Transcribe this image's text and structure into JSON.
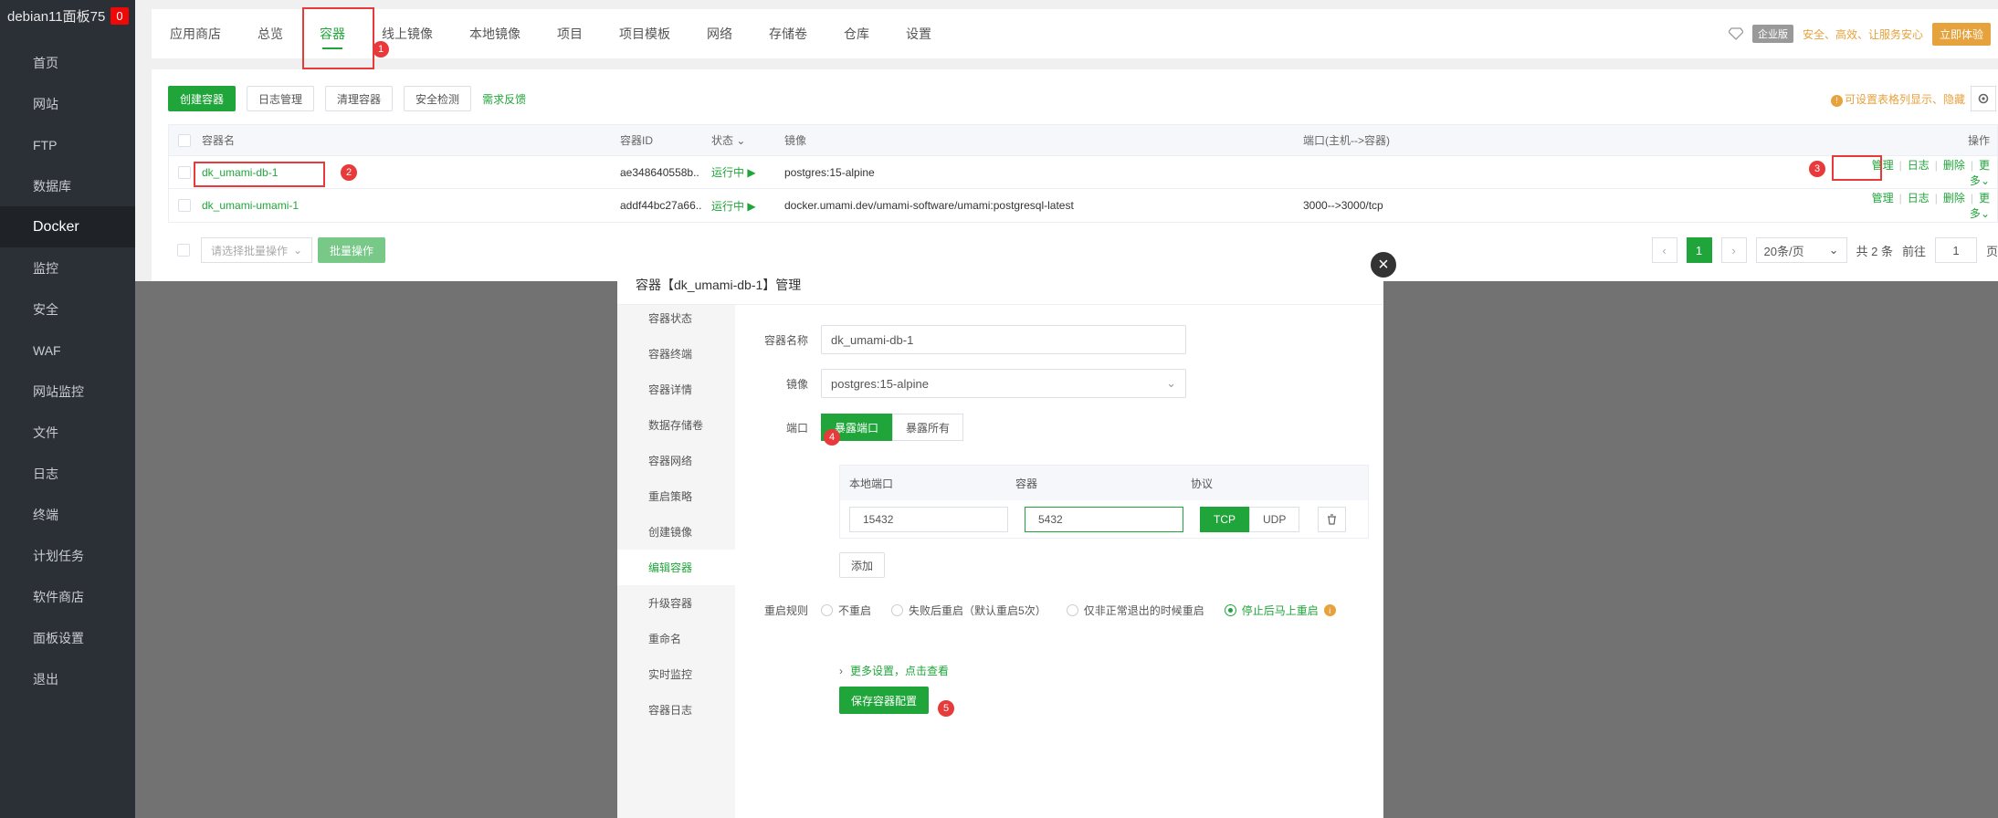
{
  "sidebar": {
    "title": "debian11面板75",
    "badge": "0",
    "items": [
      {
        "label": "首页",
        "icon": "home-icon"
      },
      {
        "label": "网站",
        "icon": "globe-icon"
      },
      {
        "label": "FTP",
        "icon": "ftp-icon"
      },
      {
        "label": "数据库",
        "icon": "database-icon"
      },
      {
        "label": "Docker",
        "icon": "docker-icon"
      },
      {
        "label": "监控",
        "icon": "monitor-icon"
      },
      {
        "label": "安全",
        "icon": "shield-icon"
      },
      {
        "label": "WAF",
        "icon": "waf-icon"
      },
      {
        "label": "网站监控",
        "icon": "site-monitor-icon"
      },
      {
        "label": "文件",
        "icon": "folder-icon"
      },
      {
        "label": "日志",
        "icon": "log-icon"
      },
      {
        "label": "终端",
        "icon": "terminal-icon"
      },
      {
        "label": "计划任务",
        "icon": "clock-icon"
      },
      {
        "label": "软件商店",
        "icon": "store-icon"
      },
      {
        "label": "面板设置",
        "icon": "settings-icon"
      },
      {
        "label": "退出",
        "icon": "logout-icon"
      }
    ]
  },
  "topnav": {
    "tabs": [
      "应用商店",
      "总览",
      "容器",
      "线上镜像",
      "本地镜像",
      "项目",
      "项目模板",
      "网络",
      "存储卷",
      "仓库",
      "设置"
    ],
    "active_index": 2,
    "ent_badge": "企业版",
    "slogan": "安全、高效、让服务安心",
    "buy": "立即体验"
  },
  "toolbar": {
    "create": "创建容器",
    "logs": "日志管理",
    "clean": "清理容器",
    "security": "安全检测",
    "feedback": "需求反馈",
    "hint": "可设置表格列显示、隐藏"
  },
  "table": {
    "headers": {
      "name": "容器名",
      "id": "容器ID",
      "status": "状态",
      "image": "镜像",
      "port": "端口(主机-->容器)",
      "ops": "操作"
    },
    "rows": [
      {
        "name": "dk_umami-db-1",
        "id": "ae348640558b..",
        "status": "运行中",
        "image": "postgres:15-alpine",
        "port": ""
      },
      {
        "name": "dk_umami-umami-1",
        "id": "addf44bc27a66..",
        "status": "运行中",
        "image": "docker.umami.dev/umami-software/umami:postgresql-latest",
        "port": "3000-->3000/tcp"
      }
    ],
    "ops": {
      "manage": "管理",
      "log": "日志",
      "delete": "删除",
      "more": "更多"
    }
  },
  "bottom": {
    "batch_select": "请选择批量操作",
    "batch_btn": "批量操作",
    "page": "1",
    "page_size": "20条/页",
    "total": "共 2 条",
    "goto": "前往",
    "goto_val": "1",
    "page_unit": "页"
  },
  "modal": {
    "title": "容器【dk_umami-db-1】管理",
    "side": [
      "容器状态",
      "容器终端",
      "容器详情",
      "数据存储卷",
      "容器网络",
      "重启策略",
      "创建镜像",
      "编辑容器",
      "升级容器",
      "重命名",
      "实时监控",
      "容器日志"
    ],
    "side_active": 7,
    "name_label": "容器名称",
    "name_value": "dk_umami-db-1",
    "image_label": "镜像",
    "image_value": "postgres:15-alpine",
    "port_label": "端口",
    "expose_port": "暴露端口",
    "expose_all": "暴露所有",
    "ports_head": {
      "local": "本地端口",
      "container": "容器",
      "protocol": "协议"
    },
    "local_port": "15432",
    "container_port": "5432",
    "tcp": "TCP",
    "udp": "UDP",
    "add": "添加",
    "restart_label": "重启规则",
    "restart_options": [
      "不重启",
      "失败后重启（默认重启5次）",
      "仅非正常退出的时候重启",
      "停止后马上重启"
    ],
    "restart_selected": 3,
    "more_settings": "更多设置，点击查看",
    "save": "保存容器配置"
  },
  "annotations": [
    "1",
    "2",
    "3",
    "4",
    "5"
  ]
}
